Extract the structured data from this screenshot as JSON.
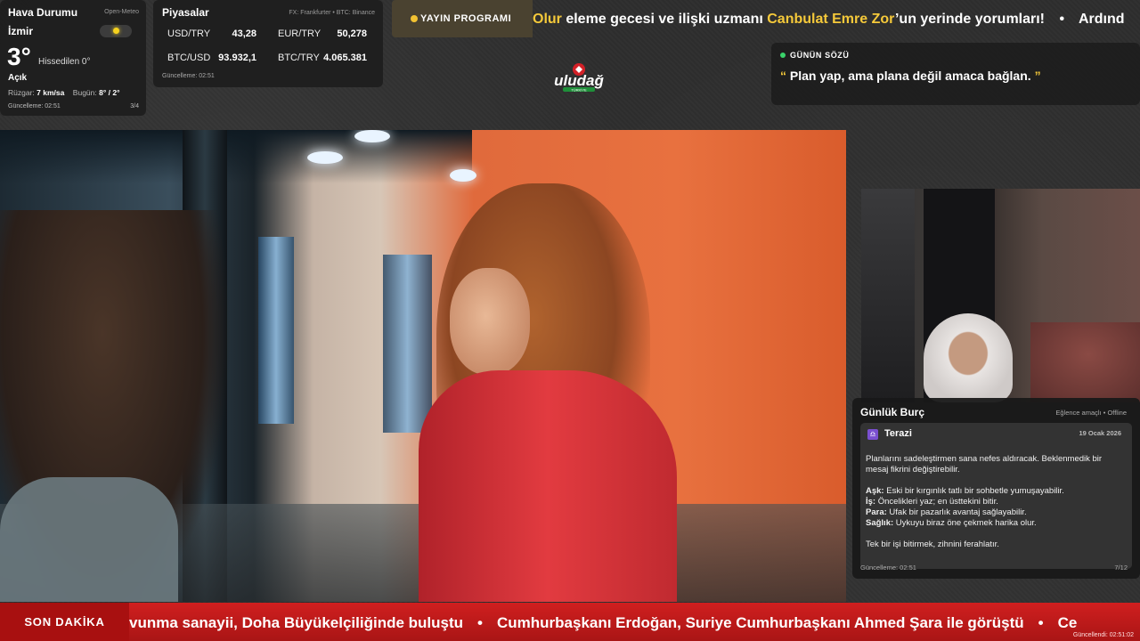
{
  "weather": {
    "title": "Hava Durumu",
    "source": "Open-Meteo",
    "city": "İzmir",
    "temp": "3°",
    "feels_like": "Hissedilen 0°",
    "condition": "Açık",
    "wind_label": "Rüzgar:",
    "wind_value": "7 km/sa",
    "today_label": "Bugün:",
    "today_value": "8° / 2°",
    "updated": "Güncelleme: 02:51",
    "pager": "3/4"
  },
  "markets": {
    "title": "Piyasalar",
    "source": "FX: Frankfurter • BTC: Binance",
    "items": [
      {
        "label": "USD/TRY",
        "value": "43,28"
      },
      {
        "label": "EUR/TRY",
        "value": "50,278"
      },
      {
        "label": "BTC/USD",
        "value": "93.932,1"
      },
      {
        "label": "BTC/TRY",
        "value": "4.065.381"
      }
    ],
    "updated": "Güncelleme: 02:51"
  },
  "program": {
    "badge": "YAYIN PROGRAMI",
    "part1": "Olur",
    "part2": " eleme gecesi ve ilişki uzmanı ",
    "part3": "Canbulat Emre Zor",
    "part4": "’un yerinde yorumları!",
    "bullet": "•",
    "part5": "Ardınd"
  },
  "logo": {
    "text": "uludağ",
    "sub": "TÜRKİYE"
  },
  "quote": {
    "title": "GÜNÜN SÖZÜ",
    "open": "“",
    "text": "Plan yap, ama plana değil amaca bağlan.",
    "close": "”"
  },
  "horoscope": {
    "title": "Günlük Burç",
    "mode": "Eğlence amaçlı • Offline",
    "sign_icon": "♎",
    "sign": "Terazi",
    "date": "19 Ocak 2026",
    "intro": "Planlarını sadeleştirmen sana nefes aldıracak. Beklenmedik bir mesaj fikrini değiştirebilir.",
    "love_label": "Aşk:",
    "love": " Eski bir kırgınlık tatlı bir sohbetle yumuşayabilir.",
    "work_label": "İş:",
    "work": " Öncelikleri yaz; en üsttekini bitir.",
    "money_label": "Para:",
    "money": " Ufak bir pazarlık avantaj sağlayabilir.",
    "health_label": "Sağlık:",
    "health": " Uykuyu biraz öne çekmek harika olur.",
    "tip": "Tek bir işi bitirmek, zihnini ferahlatır.",
    "updated": "Güncelleme: 02:51",
    "pager": "7/12"
  },
  "news": {
    "label": "SON DAKİKA",
    "item1": "vunma sanayii, Doha Büyükelçiliğinde buluştu",
    "item2": "Cumhurbaşkanı Erdoğan, Suriye Cumhurbaşkanı Ahmed Şara ile görüştü",
    "item3": "Ce",
    "bullet": "•",
    "updated": "Güncellendi: 02:51:02"
  },
  "colors": {
    "accent_yellow": "#f5c93a",
    "breaking_red": "#d01f1f",
    "quote_dot_green": "#3ad36b"
  }
}
